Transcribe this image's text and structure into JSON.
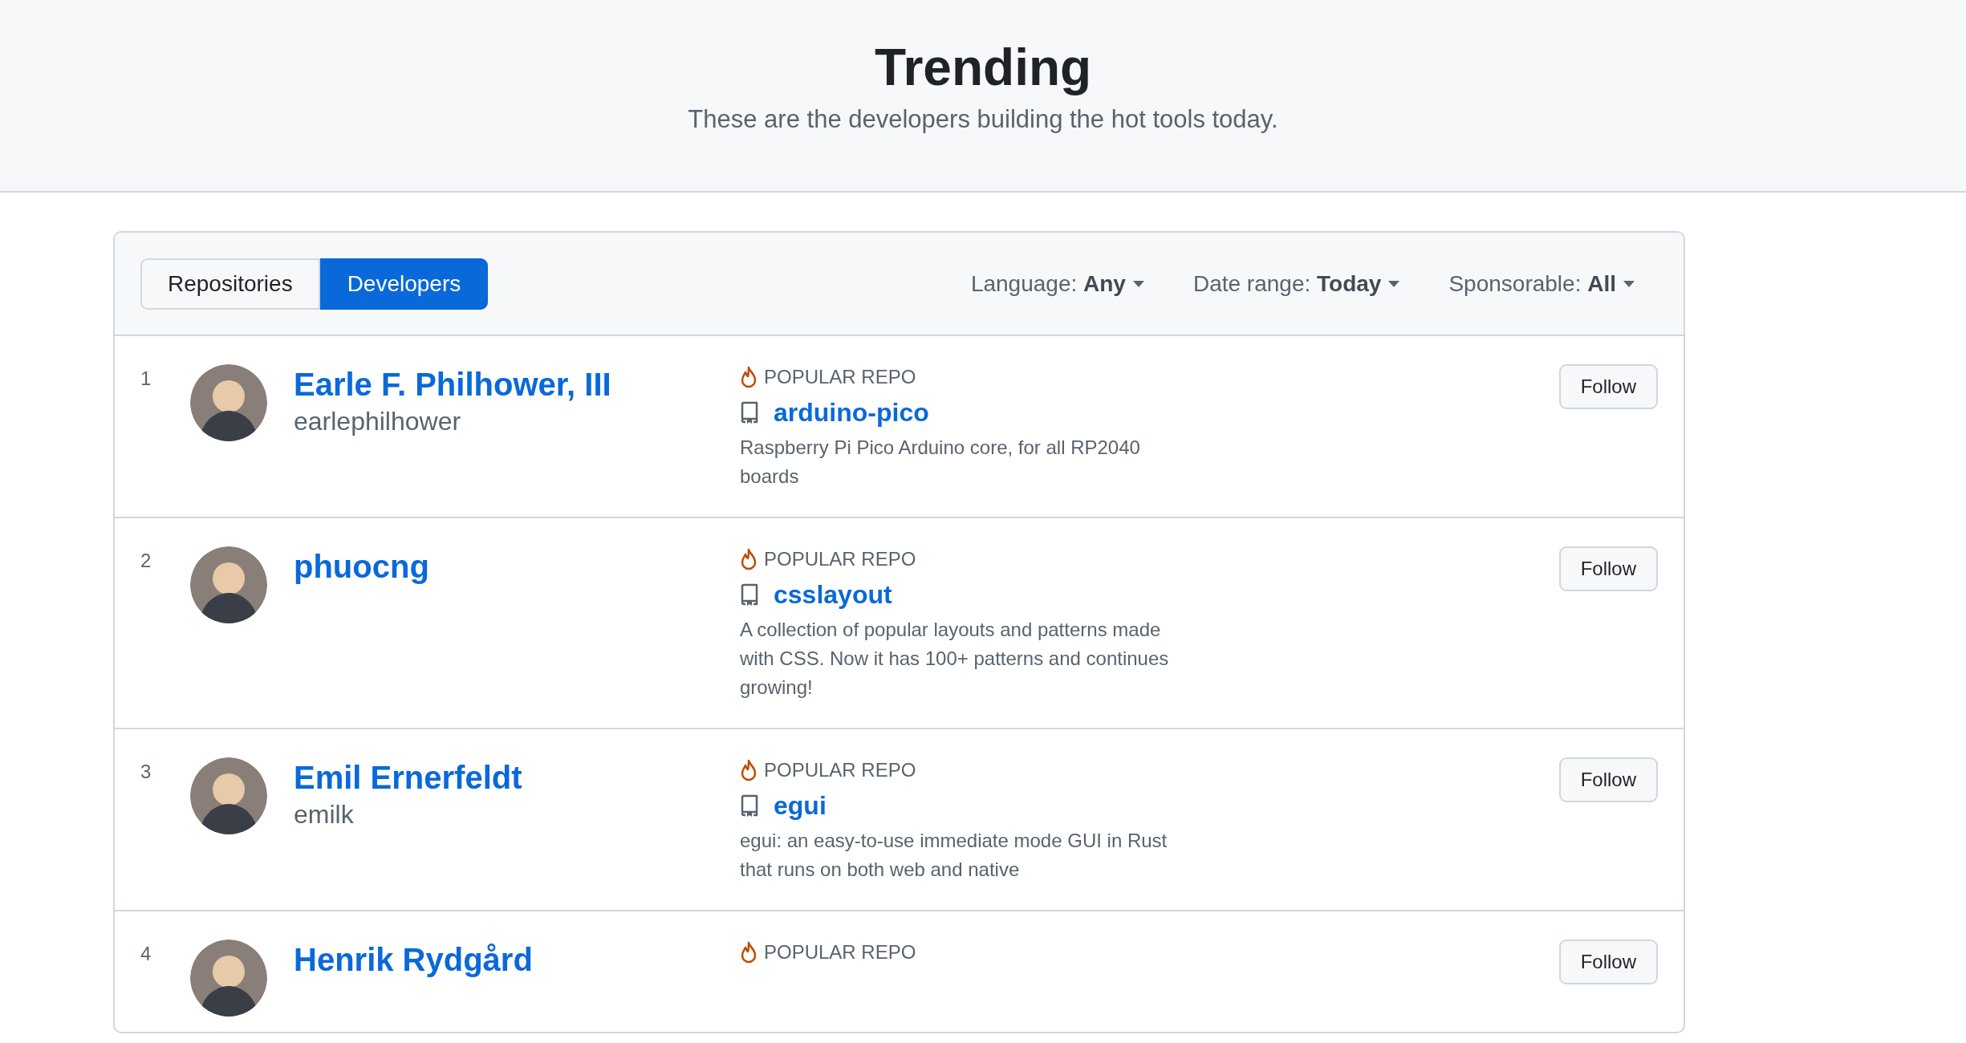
{
  "header": {
    "title": "Trending",
    "subtitle": "These are the developers building the hot tools today."
  },
  "tabs": [
    {
      "label": "Repositories",
      "selected": false
    },
    {
      "label": "Developers",
      "selected": true
    }
  ],
  "filters": [
    {
      "label": "Language:",
      "value": "Any"
    },
    {
      "label": "Date range:",
      "value": "Today"
    },
    {
      "label": "Sponsorable:",
      "value": "All"
    }
  ],
  "developers": [
    {
      "rank": "1",
      "name": "Earle F. Philhower, III",
      "username": "earlephilhower",
      "popular_label": "POPULAR REPO",
      "repo": "arduino-pico",
      "description": "Raspberry Pi Pico Arduino core, for all RP2040 boards",
      "follow": "Follow"
    },
    {
      "rank": "2",
      "name": "phuocng",
      "popular_label": "POPULAR REPO",
      "repo": "csslayout",
      "description": "A collection of popular layouts and patterns made with CSS. Now it has 100+ patterns and continues growing!",
      "follow": "Follow"
    },
    {
      "rank": "3",
      "name": "Emil Ernerfeldt",
      "username": "emilk",
      "popular_label": "POPULAR REPO",
      "repo": "egui",
      "description": "egui: an easy-to-use immediate mode GUI in Rust that runs on both web and native",
      "follow": "Follow"
    },
    {
      "rank": "4",
      "name": "Henrik Rydgård",
      "popular_label": "POPULAR REPO",
      "follow": "Follow"
    }
  ]
}
